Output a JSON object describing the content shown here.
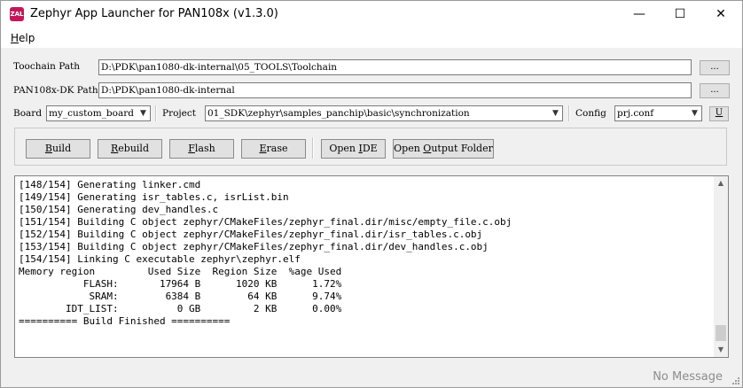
{
  "window": {
    "title": "Zephyr App Launcher for PAN108x (v1.3.0)",
    "icon_text": "ZAL",
    "minimize": "—",
    "maximize": "☐",
    "close": "✕"
  },
  "menu": {
    "help_underlined": "H",
    "help_rest": "elp"
  },
  "paths": {
    "toolchain_label": "Toochain Path",
    "toolchain_value": "D:\\PDK\\pan1080-dk-internal\\05_TOOLS\\Toolchain",
    "toolchain_browse": "...",
    "dk_label": "PAN108x-DK Path",
    "dk_value": "D:\\PDK\\pan1080-dk-internal",
    "dk_browse": "..."
  },
  "config_row": {
    "board_label": "Board",
    "board_value": "my_custom_board",
    "project_label": "Project",
    "project_value": "01_SDK\\zephyr\\samples_panchip\\basic\\synchronization",
    "config_label": "Config",
    "config_value": "prj.conf",
    "u_button": "U"
  },
  "toolbar": {
    "build_u": "B",
    "build_rest": "uild",
    "rebuild_u": "R",
    "rebuild_rest": "ebuild",
    "flash_u": "F",
    "flash_rest": "lash",
    "erase_u": "E",
    "erase_rest": "rase",
    "open_ide_pre": "Open ",
    "open_ide_u": "I",
    "open_ide_post": "DE",
    "open_output_pre": "Open ",
    "open_output_u": "O",
    "open_output_post": "utput Folder"
  },
  "console": {
    "lines": "[148/154] Generating linker.cmd\n[149/154] Generating isr_tables.c, isrList.bin\n[150/154] Generating dev_handles.c\n[151/154] Building C object zephyr/CMakeFiles/zephyr_final.dir/misc/empty_file.c.obj\n[152/154] Building C object zephyr/CMakeFiles/zephyr_final.dir/isr_tables.c.obj\n[153/154] Building C object zephyr/CMakeFiles/zephyr_final.dir/dev_handles.c.obj\n[154/154] Linking C executable zephyr\\zephyr.elf\nMemory region         Used Size  Region Size  %age Used\n           FLASH:       17964 B      1020 KB      1.72%\n            SRAM:        6384 B        64 KB      9.74%\n        IDT_LIST:          0 GB         2 KB      0.00%\n========== Build Finished =========="
  },
  "status": {
    "message": "No Message"
  }
}
